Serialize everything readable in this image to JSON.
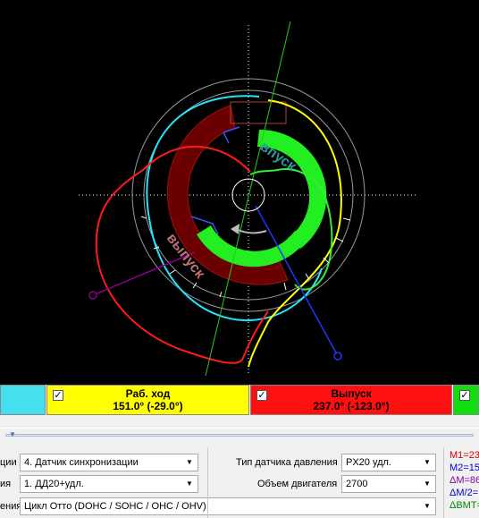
{
  "diagram": {
    "label_intake": "впуск",
    "label_exhaust": "выпуск"
  },
  "phases": [
    {
      "name": "",
      "value": "",
      "color": "#44e0f0",
      "checked": false
    },
    {
      "name": "Раб. ход",
      "value": "151.0° (-29.0°)",
      "color": "#ffff00",
      "checked": true
    },
    {
      "name": "Выпуск",
      "value": "237.0° (-123.0°)",
      "color": "#ff1010",
      "checked": true
    },
    {
      "name": "",
      "value": "",
      "color": "#10dd10",
      "checked": true
    }
  ],
  "settings": {
    "sync_label": "ции",
    "sync_value": "4.  Датчик синхронизации",
    "sensor_label": "ия",
    "sensor_value": "1.  ДД20+удл.",
    "cycle_label": "ения",
    "cycle_value": "Цикл Отто (DOHC / SOHC / OHC / OHV)",
    "pressure_sensor_label": "Тип датчика давления",
    "pressure_sensor_value": "PX20 удл.",
    "volume_label": "Объем двигателя",
    "volume_value": "2700"
  },
  "measurements": [
    {
      "text": "M1=23",
      "color": "#d00000"
    },
    {
      "text": "M2=15",
      "color": "#0000cc"
    },
    {
      "text": "ΔM=86",
      "color": "#8a00a8"
    },
    {
      "text": "ΔM/2=",
      "color": "#0000cc"
    },
    {
      "text": "ΔBMT=",
      "color": "#008800"
    }
  ],
  "icons": {
    "dropdown": "chevron-down-icon",
    "checkbox": "check-icon"
  }
}
